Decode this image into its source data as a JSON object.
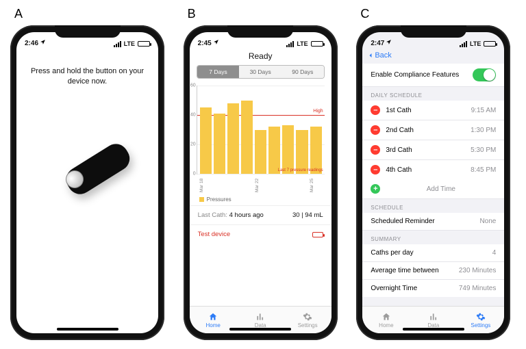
{
  "labels": {
    "A": "A",
    "B": "B",
    "C": "C"
  },
  "statusbar": {
    "carrier_text": "LTE"
  },
  "screenA": {
    "time": "2:46",
    "instruction": "Press and hold the button on your device now."
  },
  "screenB": {
    "time": "2:45",
    "title": "Ready",
    "segments": [
      "7 Days",
      "30 Days",
      "90 Days"
    ],
    "selected_segment": 0,
    "threshold_label": "High",
    "threshold_value": 40,
    "readings_note": "Last 7 pressure readings",
    "legend": "Pressures",
    "last_cath_label": "Last Cath:",
    "last_cath_value": "4 hours ago",
    "summary_value": "30 | 94 mL",
    "test_device": "Test device",
    "tabs": [
      "Home",
      "Data",
      "Settings"
    ],
    "active_tab": 0
  },
  "screenC": {
    "time": "2:47",
    "back": "Back",
    "enable_label": "Enable Compliance Features",
    "enable_on": true,
    "sections": {
      "daily": "DAILY SCHEDULE",
      "schedule": "SCHEDULE",
      "summary": "SUMMARY"
    },
    "caths": [
      {
        "name": "1st Cath",
        "time": "9:15 AM"
      },
      {
        "name": "2nd Cath",
        "time": "1:30 PM"
      },
      {
        "name": "3rd Cath",
        "time": "5:30 PM"
      },
      {
        "name": "4th Cath",
        "time": "8:45 PM"
      }
    ],
    "add_time": "Add Time",
    "reminder_label": "Scheduled Reminder",
    "reminder_value": "None",
    "summary_rows": [
      {
        "label": "Caths per day",
        "value": "4"
      },
      {
        "label": "Average time between",
        "value": "230 Minutes"
      },
      {
        "label": "Overnight Time",
        "value": "749 Minutes"
      }
    ],
    "tabs": [
      "Home",
      "Data",
      "Settings"
    ],
    "active_tab": 2
  },
  "chart_data": {
    "type": "bar",
    "title": "Ready",
    "ylabel": "",
    "xlabel": "",
    "ylim": [
      0,
      60
    ],
    "yticks": [
      0,
      20,
      40,
      60
    ],
    "threshold": {
      "label": "High",
      "value": 40
    },
    "categories": [
      "Mar 18",
      "",
      "",
      "",
      "Mar 22",
      "",
      "",
      "",
      "Mar 25"
    ],
    "values": [
      45,
      41,
      48,
      50,
      30,
      32,
      33,
      30,
      32
    ],
    "legend": [
      "Pressures"
    ],
    "note": "Last 7 pressure readings"
  }
}
